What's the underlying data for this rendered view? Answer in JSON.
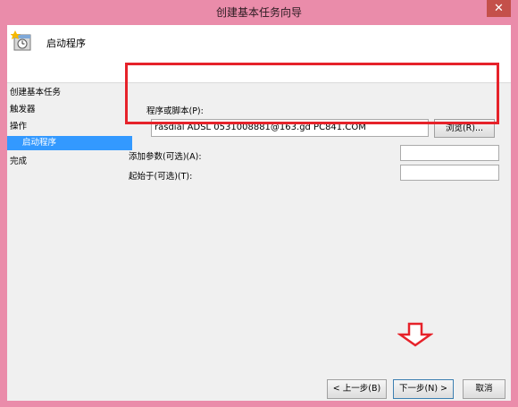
{
  "window": {
    "title": "创建基本任务向导",
    "close_glyph": "✕"
  },
  "header": {
    "title": "启动程序",
    "icon": "task-scheduler-icon"
  },
  "nav": {
    "items": [
      {
        "label": "创建基本任务"
      },
      {
        "label": "触发器"
      },
      {
        "label": "操作"
      },
      {
        "label": "启动程序",
        "selected": true
      },
      {
        "label": "完成"
      }
    ]
  },
  "form": {
    "program_label": "程序或脚本(P):",
    "program_value": "rasdial ADSL 0531008881@163.gd PC841.COM",
    "browse_label": "浏览(R)...",
    "args_label": "添加参数(可选)(A):",
    "args_value": "",
    "startin_label": "起始于(可选)(T):",
    "startin_value": ""
  },
  "footer": {
    "back_label": "< 上一步(B)",
    "next_label": "下一步(N) >",
    "cancel_label": "取消"
  },
  "colors": {
    "window_frame": "#ea8caa",
    "selection": "#3399ff",
    "annotation": "#e6222a"
  }
}
